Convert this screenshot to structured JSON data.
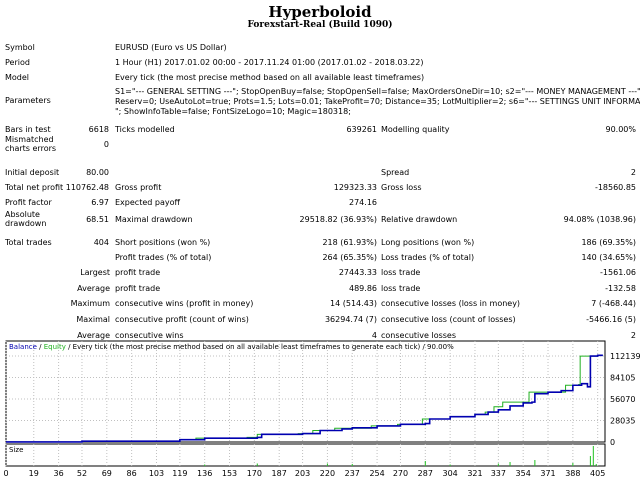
{
  "header": {
    "title": "Hyperboloid",
    "subtitle": "Forexstart-Real (Build 1090)"
  },
  "info": {
    "symbol_label": "Symbol",
    "symbol": "EURUSD (Euro vs US Dollar)",
    "period_label": "Period",
    "period": "1 Hour (H1) 2017.01.02 00:00 - 2017.11.24 01:00 (2017.01.02 - 2018.03.22)",
    "model_label": "Model",
    "model": "Every tick (the most precise method based on all available least timeframes)",
    "params_label": "Parameters",
    "params_1": "S1=\"--- GENERAL SETTING ---\"; StopOpenBuy=false; StopOpenSell=false; MaxOrdersOneDir=10; s2=\"--- MONEY MANAGEMENT ---\";",
    "params_2": "Reserv=0; UseAutoLot=true; Prots=1.5; Lots=0.01; TakeProfit=70; Distance=35; LotMultiplier=2; s6=\"--- SETTINGS UNIT INFORMATION ---",
    "params_3": "\"; ShowInfoTable=false; FontSizeLogo=10; Magic=180318;"
  },
  "rows": [
    {
      "l1": "Bars in test",
      "v1": "6618",
      "l2": "Ticks modelled",
      "v2": "639261",
      "l3": "Modelling quality",
      "v3": "90.00%"
    },
    {
      "l1": "Mismatched charts errors",
      "v1": "0",
      "l2": "",
      "v2": "",
      "l3": "",
      "v3": ""
    },
    {
      "l1": "Initial deposit",
      "v1": "80.00",
      "l2": "",
      "v2": "",
      "l3": "Spread",
      "v3": "2"
    },
    {
      "l1": "Total net profit",
      "v1": "110762.48",
      "l2": "Gross profit",
      "v2": "129323.33",
      "l3": "Gross loss",
      "v3": "-18560.85"
    },
    {
      "l1": "Profit factor",
      "v1": "6.97",
      "l2": "Expected payoff",
      "v2": "274.16",
      "l3": "",
      "v3": ""
    },
    {
      "l1": "Absolute drawdown",
      "v1": "68.51",
      "l2": "Maximal drawdown",
      "v2": "29518.82 (36.93%)",
      "l3": "Relative drawdown",
      "v3": "94.08% (1038.96)"
    },
    {
      "l1": "Total trades",
      "v1": "404",
      "l2": "Short positions (won %)",
      "v2": "218 (61.93%)",
      "l3": "Long positions (won %)",
      "v3": "186 (69.35%)"
    },
    {
      "l1": "",
      "v1": "",
      "l2": "Profit trades (% of total)",
      "v2": "264 (65.35%)",
      "l3": "Loss trades (% of total)",
      "v3": "140 (34.65%)"
    },
    {
      "l1": "Largest",
      "v1": "",
      "l2": "profit trade",
      "v2": "27443.33",
      "l3": "loss trade",
      "v3": "-1561.06"
    },
    {
      "l1": "Average",
      "v1": "",
      "l2": "profit trade",
      "v2": "489.86",
      "l3": "loss trade",
      "v3": "-132.58"
    },
    {
      "l1": "Maximum",
      "v1": "",
      "l2": "consecutive wins (profit in money)",
      "v2": "14 (514.43)",
      "l3": "consecutive losses (loss in money)",
      "v3": "7 (-468.44)"
    },
    {
      "l1": "Maximal",
      "v1": "",
      "l2": "consecutive profit (count of wins)",
      "v2": "36294.74 (7)",
      "l3": "consecutive loss (count of losses)",
      "v3": "-5466.16 (5)"
    },
    {
      "l1": "Average",
      "v1": "",
      "l2": "consecutive wins",
      "v2": "4",
      "l3": "consecutive losses",
      "v3": "2"
    }
  ],
  "colors": {
    "balance": "#0000b0",
    "equity": "#20b020",
    "size": "#20c020",
    "grid": "#c0c0c0"
  },
  "chart_data": {
    "type": "line",
    "legend": {
      "balance": "Balance",
      "sep1": " / ",
      "equity": "Equity",
      "rest": " / Every tick (the most precise method based on all available least timeframes to generate each tick) / 90.00%"
    },
    "size_label": "Size",
    "ylim": [
      0,
      112139
    ],
    "xlim": [
      0,
      410
    ],
    "y_ticks": [
      "0",
      "28035",
      "56070",
      "84105",
      "112139"
    ],
    "x_ticks": [
      "0",
      "19",
      "36",
      "52",
      "69",
      "86",
      "103",
      "119",
      "136",
      "153",
      "170",
      "187",
      "203",
      "220",
      "237",
      "254",
      "270",
      "287",
      "304",
      "321",
      "337",
      "354",
      "371",
      "388",
      "405"
    ],
    "balance": [
      [
        0,
        80
      ],
      [
        52,
        1000
      ],
      [
        119,
        3000
      ],
      [
        136,
        5000
      ],
      [
        172,
        6000
      ],
      [
        175,
        10000
      ],
      [
        203,
        11000
      ],
      [
        215,
        15000
      ],
      [
        230,
        17000
      ],
      [
        237,
        18500
      ],
      [
        254,
        21000
      ],
      [
        270,
        23000
      ],
      [
        287,
        24000
      ],
      [
        290,
        30000
      ],
      [
        304,
        33000
      ],
      [
        321,
        36000
      ],
      [
        330,
        39000
      ],
      [
        337,
        42000
      ],
      [
        345,
        47000
      ],
      [
        354,
        51000
      ],
      [
        360,
        52000
      ],
      [
        362,
        63000
      ],
      [
        371,
        65000
      ],
      [
        380,
        67000
      ],
      [
        388,
        74000
      ],
      [
        394,
        76000
      ],
      [
        398,
        72000
      ],
      [
        400,
        112000
      ],
      [
        405,
        113000
      ],
      [
        408,
        112000
      ]
    ],
    "equity": [
      [
        0,
        80
      ],
      [
        52,
        1000
      ],
      [
        119,
        3000
      ],
      [
        130,
        5000
      ],
      [
        165,
        6000
      ],
      [
        172,
        10000
      ],
      [
        200,
        11000
      ],
      [
        210,
        15000
      ],
      [
        225,
        18000
      ],
      [
        250,
        21000
      ],
      [
        268,
        23000
      ],
      [
        285,
        30000
      ],
      [
        304,
        33000
      ],
      [
        321,
        36000
      ],
      [
        328,
        39000
      ],
      [
        334,
        46000
      ],
      [
        340,
        52000
      ],
      [
        356,
        52000
      ],
      [
        358,
        65000
      ],
      [
        371,
        65000
      ],
      [
        383,
        74000
      ],
      [
        392,
        75000
      ],
      [
        393,
        112000
      ],
      [
        405,
        113000
      ],
      [
        408,
        112000
      ]
    ],
    "size": [
      [
        136,
        3
      ],
      [
        172,
        5
      ],
      [
        220,
        5
      ],
      [
        237,
        4
      ],
      [
        287,
        10
      ],
      [
        304,
        3
      ],
      [
        337,
        5
      ],
      [
        345,
        8
      ],
      [
        362,
        12
      ],
      [
        388,
        6
      ],
      [
        400,
        20
      ],
      [
        402,
        40
      ],
      [
        404,
        4
      ]
    ]
  }
}
